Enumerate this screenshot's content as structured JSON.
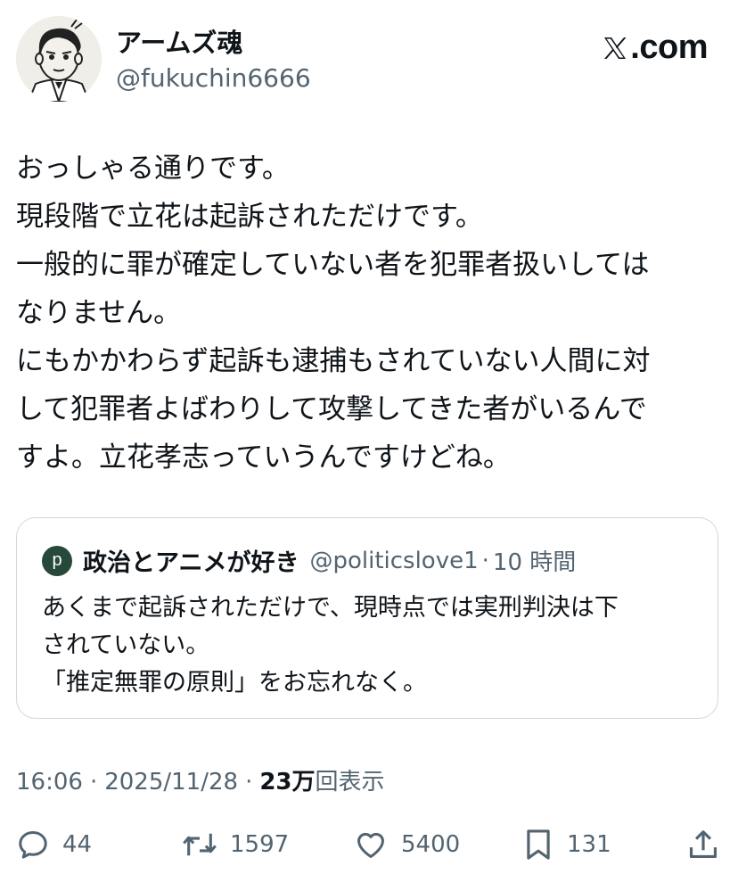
{
  "author": {
    "display_name": "アームズ魂",
    "handle": "@fukuchin6666",
    "avatar_icon": "cartoon-man-avatar"
  },
  "brand": {
    "label": "X.com",
    "icon": "x-logo-icon"
  },
  "tweet": {
    "text": "おっしゃる通りです。\n現段階で立花は起訴されただけです。\n一般的に罪が確定していない者を犯罪者扱いしては\nなりません。\nにもかかわらず起訴も逮捕もされていない人間に対\nして犯罪者よばわりして攻撃してきた者がいるんで\nすよ。立花孝志っていうんですけどね。"
  },
  "quote": {
    "avatar_letter": "p",
    "display_name": "政治とアニメが好き",
    "handle": "@politicslove1",
    "separator": "·",
    "time": "10 時間",
    "text": "あくまで起訴されただけで、現時点では実刑判決は下\nされていない。\n「推定無罪の原則」をお忘れなく。"
  },
  "meta": {
    "time": "16:06",
    "separator": "·",
    "date": "2025/11/28",
    "views_count": "23万",
    "views_label": "回表示"
  },
  "actions": {
    "replies": "44",
    "reposts": "1597",
    "likes": "5400",
    "bookmarks": "131"
  },
  "colors": {
    "text": "#0f1419",
    "secondary": "#536471",
    "border": "#cfd9de",
    "quote_avatar_bg": "#26493a"
  }
}
